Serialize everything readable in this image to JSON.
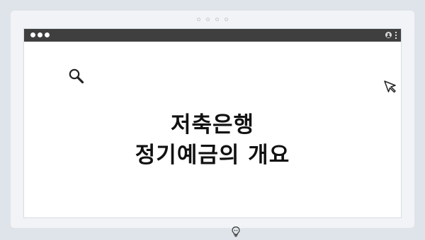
{
  "frame": {
    "dot_count": 4
  },
  "window": {
    "titlebar_color": "#3f3f3f",
    "titlebar_icons": [
      "user-icon",
      "kebab-menu-icon"
    ]
  },
  "icons": {
    "top_left": "search-icon",
    "top_right": "cursor-icon",
    "bottom": "lightbulb-icon"
  },
  "headline": {
    "line1": "저축은행",
    "line2": "정기예금의 개요"
  }
}
